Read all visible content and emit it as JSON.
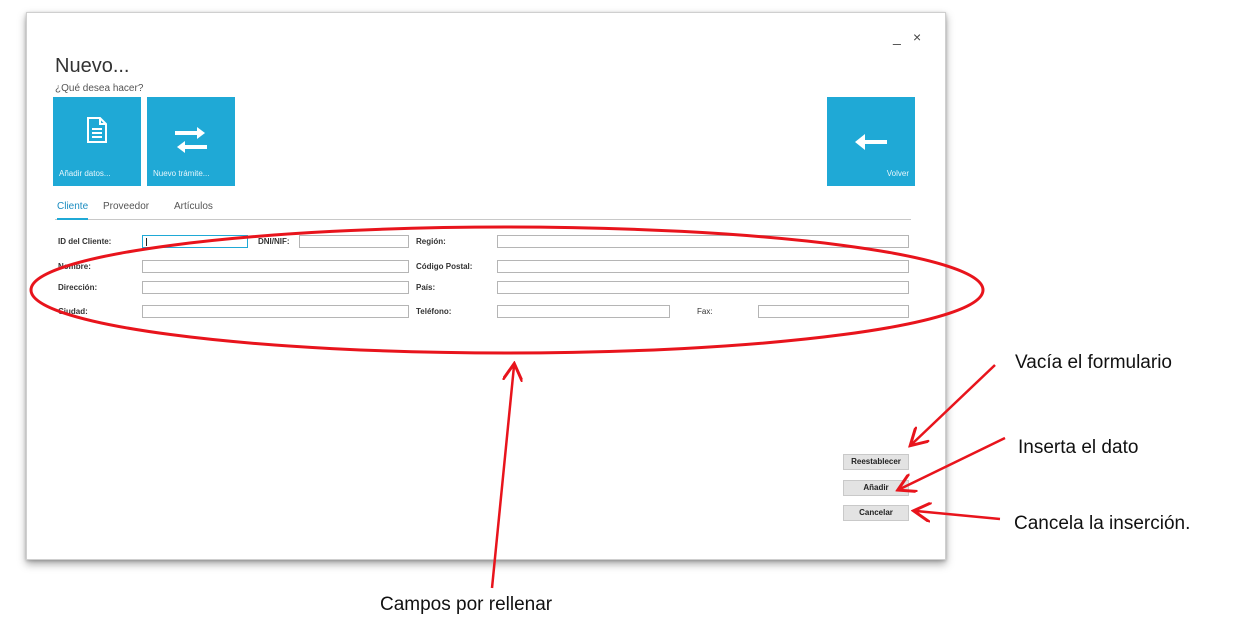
{
  "window": {
    "title": "Nuevo...",
    "subtitle": "¿Qué desea hacer?",
    "minimize_label": "_",
    "close_label": "×"
  },
  "tiles": [
    {
      "label": "Añadir datos...",
      "icon": "document-icon"
    },
    {
      "label": "Nuevo trámite...",
      "icon": "swap-arrows-icon"
    },
    {
      "label": "Volver",
      "icon": "arrow-left-icon"
    }
  ],
  "tabs": [
    "Cliente",
    "Proveedor",
    "Artículos"
  ],
  "form": {
    "id_label": "ID del Cliente:",
    "dni_label": "DNI/NIF:",
    "region_label": "Región:",
    "nombre_label": "Nombre:",
    "cp_label": "Código Postal:",
    "direccion_label": "Dirección:",
    "pais_label": "País:",
    "ciudad_label": "Ciudad:",
    "telefono_label": "Teléfono:",
    "fax_label": "Fax:"
  },
  "buttons": {
    "reset": "Reestablecer",
    "add": "Añadir",
    "cancel": "Cancelar"
  },
  "annotations": {
    "reset": "Vacía el formulario",
    "add": "Inserta el dato",
    "cancel": "Cancela la inserción.",
    "fields": "Campos por rellenar"
  },
  "colors": {
    "accent": "#1fa9d6",
    "annotation": "#e8141c"
  }
}
